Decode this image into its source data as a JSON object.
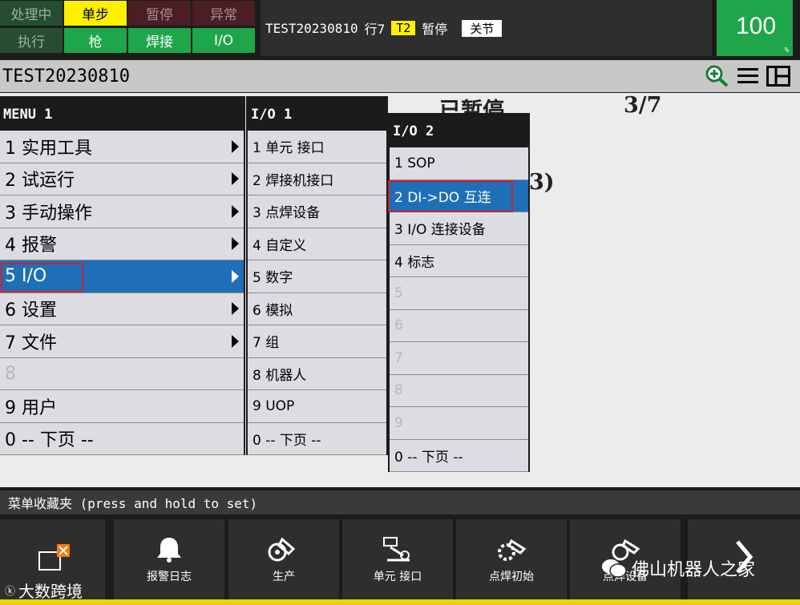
{
  "status_lamps": [
    {
      "label": "处理中",
      "state": "dark-green"
    },
    {
      "label": "单步",
      "state": "yellow"
    },
    {
      "label": "暂停",
      "state": "dark-red"
    },
    {
      "label": "异常",
      "state": "dark-red"
    },
    {
      "label": "执行",
      "state": "dark-green"
    },
    {
      "label": "枪",
      "state": "green"
    },
    {
      "label": "焊接",
      "state": "green"
    },
    {
      "label": "I/O",
      "state": "green"
    }
  ],
  "status": {
    "program": "TEST20230810",
    "line": "行7",
    "mode": "T2",
    "state": "暂停",
    "joint": "关节"
  },
  "override": {
    "value": "100",
    "unit": "%"
  },
  "title": {
    "program": "TEST20230810"
  },
  "background": {
    "paused": "已暂停",
    "progress": "3/7",
    "partial": "3)"
  },
  "menu1": {
    "header": "MENU  1",
    "items": [
      "1 实用工具",
      "2 试运行",
      "3 手动操作",
      "4 报警",
      "5 I/O",
      "6 设置",
      "7 文件",
      "8",
      "9 用户",
      "0 -- 下页 --"
    ]
  },
  "menu2": {
    "header": "I/O  1",
    "items": [
      "1 单元 接口",
      "2 焊接机接口",
      "3 点焊设备",
      "4 自定义",
      "5 数字",
      "6 模拟",
      "7 组",
      "8 机器人",
      "9 UOP",
      "0 -- 下页 --"
    ]
  },
  "menu3": {
    "header": "I/O  2",
    "items": [
      "1 SOP",
      "2 DI->DO 互连",
      "3 I/O 连接设备",
      "4 标志",
      "5",
      "6",
      "7",
      "8",
      "9",
      "0 -- 下页 --"
    ]
  },
  "favorites": {
    "label": "菜单收藏夹 (press and hold to set)"
  },
  "fkeys": [
    "报警日志",
    "生产",
    "单元 接口",
    "点焊初始",
    "点焊设备"
  ],
  "watermark": {
    "left": "大数跨境",
    "right": "佛山机器人之家"
  },
  "colors": {
    "selection": "#1e6fb8",
    "highlight_box": "#d0202a",
    "lamp_yellow": "#ffef00",
    "lamp_green": "#1fa64a"
  }
}
